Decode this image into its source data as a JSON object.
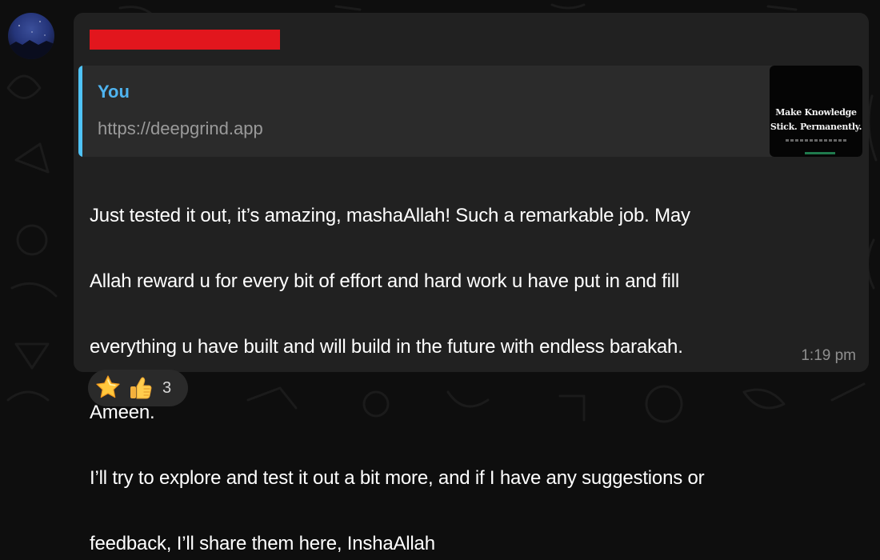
{
  "chat": {
    "sender_name": "",
    "quote": {
      "author": "You",
      "text": "https://deepgrind.app",
      "thumbnail_line1": "Make Knowledge",
      "thumbnail_line2": "Stick. Permanently."
    },
    "message_lines": [
      "Just tested it out, it’s amazing, mashaAllah! Such a remarkable job. May",
      "Allah reward u for every bit of effort and hard work u have put in and fill",
      "everything u have built and will build in the future with endless barakah.",
      "Ameen.",
      "I’ll try to explore and test it out a bit more, and if I have any suggestions or",
      "feedback, I’ll share them here, InshaAllah"
    ],
    "time": "1:19 pm",
    "reactions": {
      "emojis": [
        "star-emoji",
        "thumbs-up-emoji"
      ],
      "count": "3"
    }
  },
  "colors": {
    "background": "#0e0e0e",
    "bubble": "#212121",
    "quote_background": "#2b2b2b",
    "quote_accent": "#4fc3f7",
    "redaction": "#e2161d",
    "message_text": "#ffffff",
    "time_text": "#8f8f8f"
  }
}
